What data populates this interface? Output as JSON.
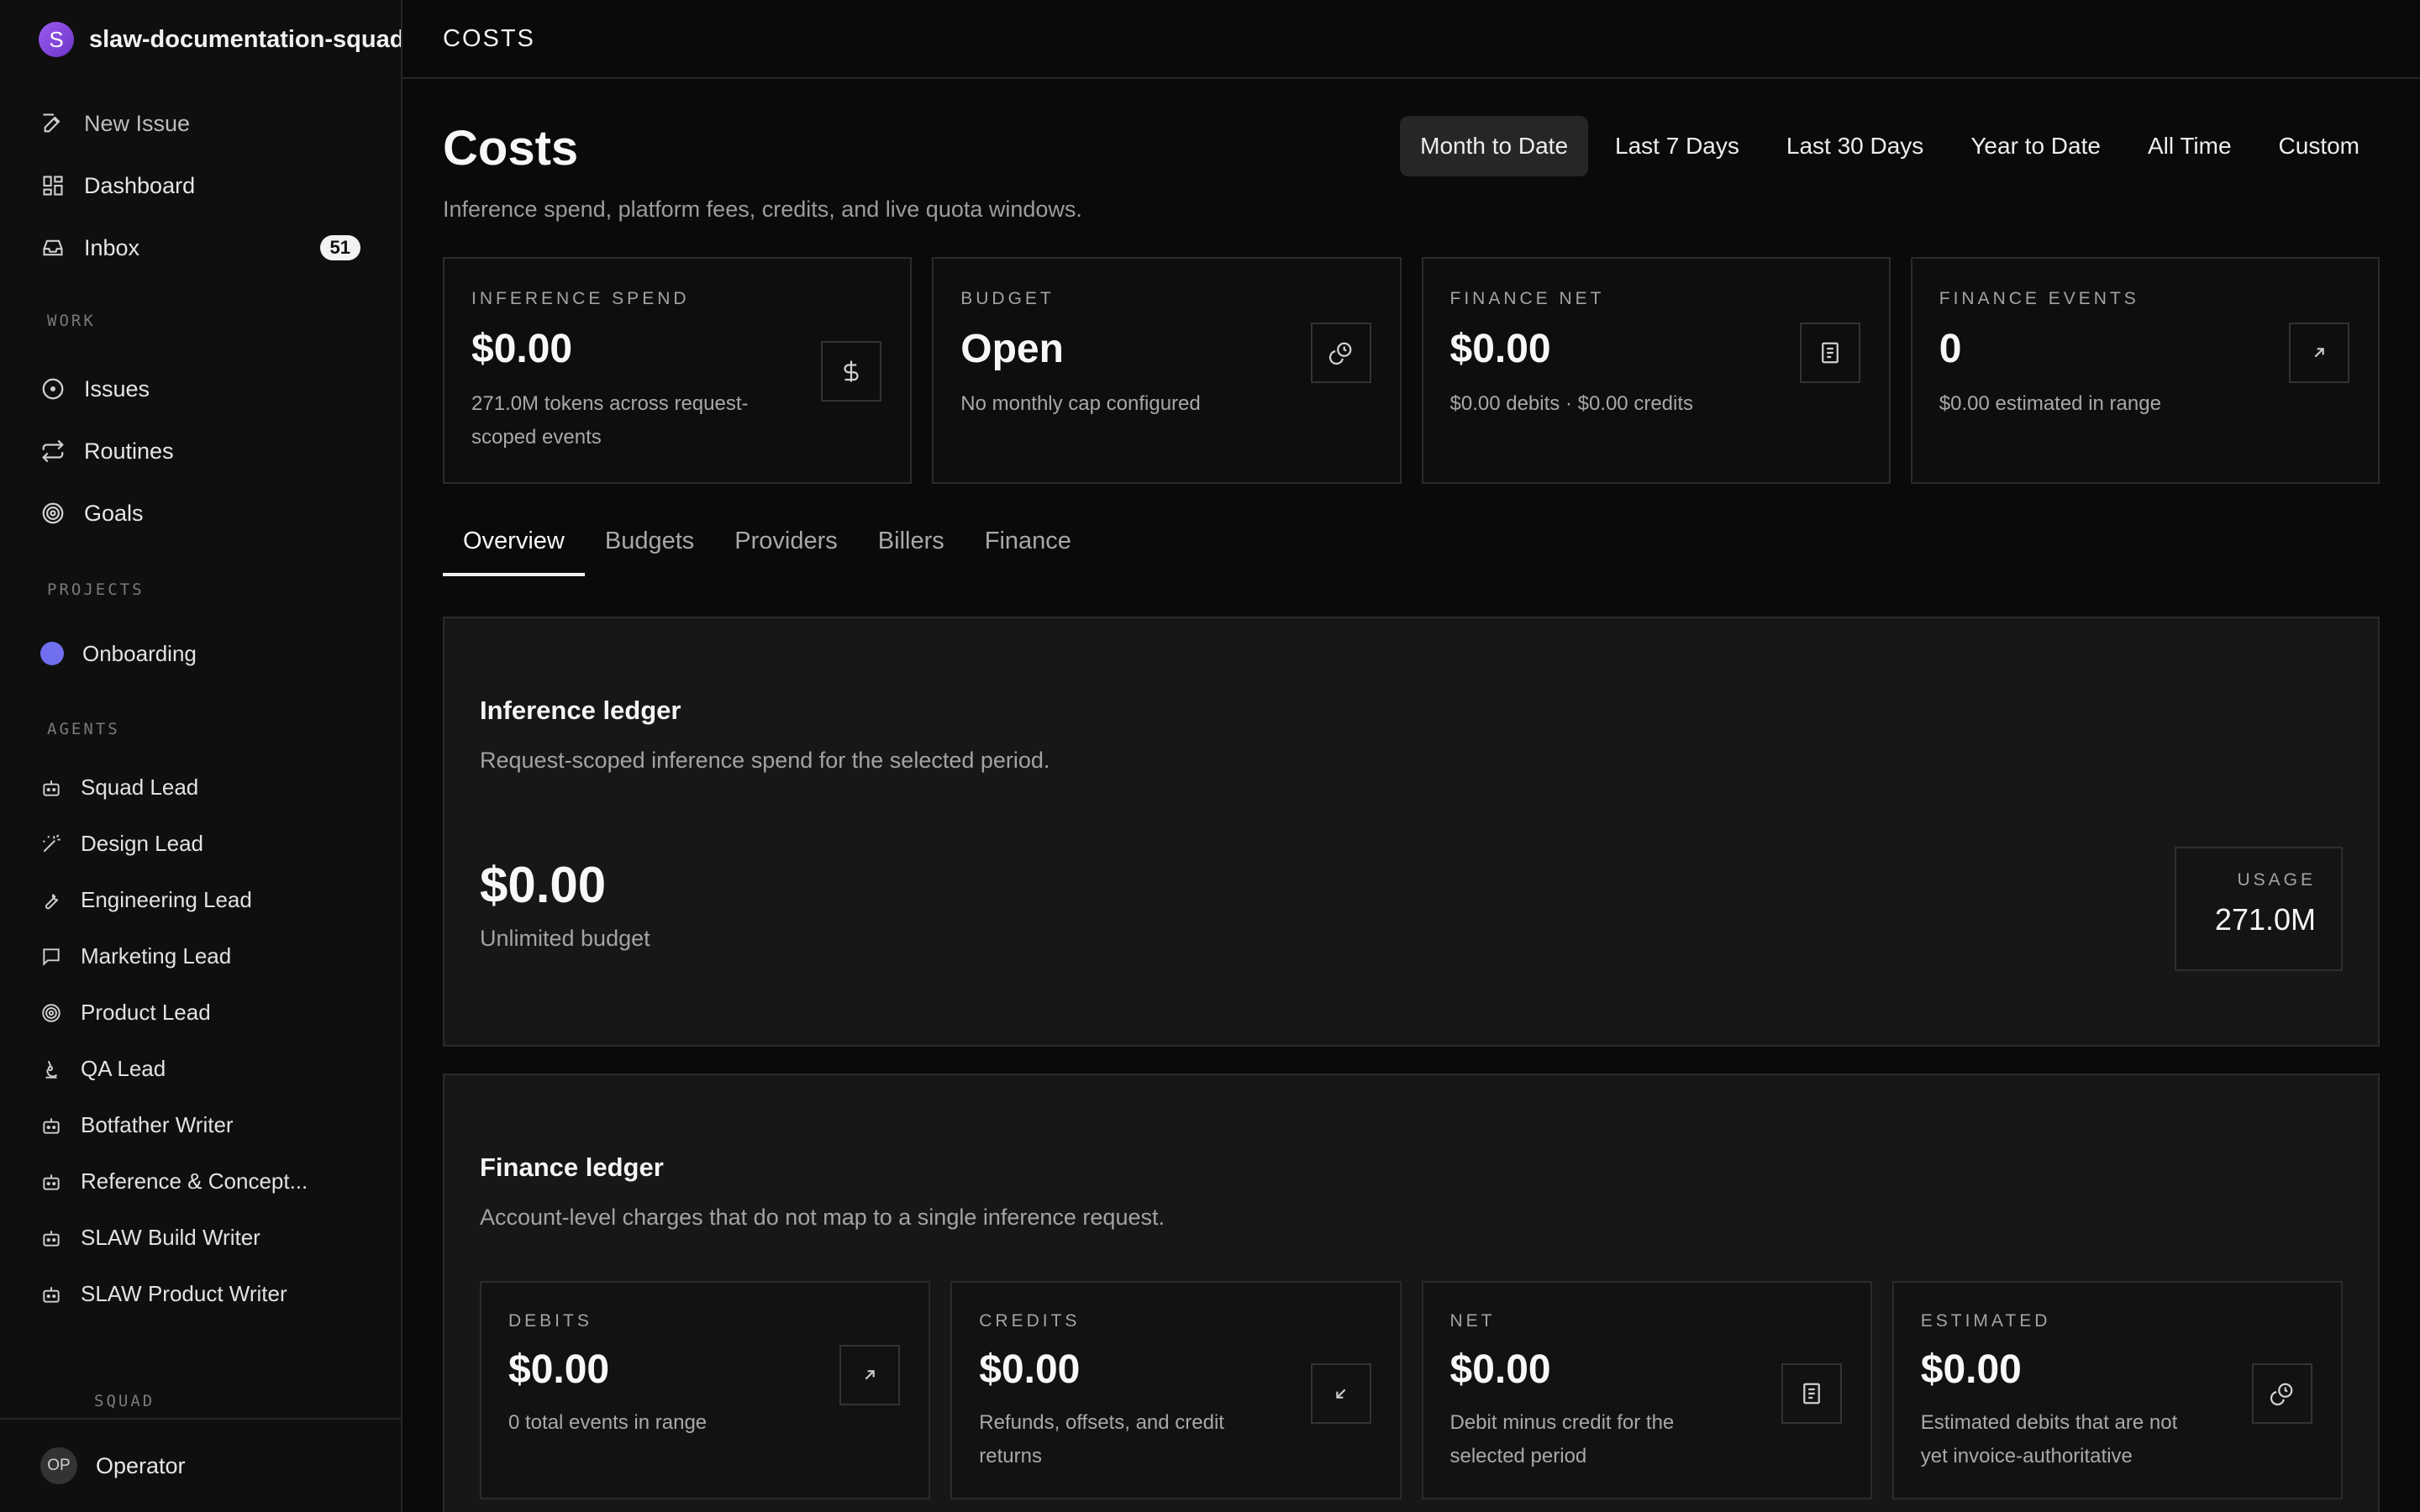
{
  "sidebar": {
    "org_initial": "S",
    "org_name": "slaw-documentation-squad",
    "nav": [
      {
        "label": "New Issue",
        "icon": "edit-icon"
      },
      {
        "label": "Dashboard",
        "icon": "grid-icon"
      },
      {
        "label": "Inbox",
        "icon": "inbox-icon",
        "badge": "51"
      }
    ],
    "work_label": "WORK",
    "work": [
      {
        "label": "Issues",
        "icon": "circle-dot-icon"
      },
      {
        "label": "Routines",
        "icon": "repeat-icon"
      },
      {
        "label": "Goals",
        "icon": "target-icon"
      }
    ],
    "projects_label": "PROJECTS",
    "projects": [
      {
        "label": "Onboarding",
        "color": "#6f6ff0"
      }
    ],
    "agents_label": "AGENTS",
    "agents": [
      {
        "label": "Squad Lead",
        "icon": "bot-icon"
      },
      {
        "label": "Design Lead",
        "icon": "wand-icon"
      },
      {
        "label": "Engineering Lead",
        "icon": "wrench-icon"
      },
      {
        "label": "Marketing Lead",
        "icon": "message-icon"
      },
      {
        "label": "Product Lead",
        "icon": "target-icon"
      },
      {
        "label": "QA Lead",
        "icon": "microscope-icon"
      },
      {
        "label": "Botfather Writer",
        "icon": "bot-icon"
      },
      {
        "label": "Reference & Concept...",
        "icon": "bot-icon"
      },
      {
        "label": "SLAW Build Writer",
        "icon": "bot-icon"
      },
      {
        "label": "SLAW Product Writer",
        "icon": "bot-icon"
      }
    ],
    "squad_label": "SQUAD",
    "user_initials": "OP",
    "user_name": "Operator"
  },
  "topbar": {
    "title": "COSTS"
  },
  "header": {
    "title": "Costs",
    "subtitle": "Inference spend, platform fees, credits, and live quota windows.",
    "ranges": [
      "Month to Date",
      "Last 7 Days",
      "Last 30 Days",
      "Year to Date",
      "All Time",
      "Custom"
    ],
    "active_range": "Month to Date"
  },
  "stats": [
    {
      "label": "INFERENCE SPEND",
      "value": "$0.00",
      "desc": "271.0M tokens across request-scoped events",
      "icon": "dollar-icon"
    },
    {
      "label": "BUDGET",
      "value": "Open",
      "desc": "No monthly cap configured",
      "icon": "coins-icon"
    },
    {
      "label": "FINANCE NET",
      "value": "$0.00",
      "desc": "$0.00 debits · $0.00 credits",
      "icon": "receipt-icon"
    },
    {
      "label": "FINANCE EVENTS",
      "value": "0",
      "desc": "$0.00 estimated in range",
      "icon": "arrow-up-right-icon"
    }
  ],
  "tabs": [
    "Overview",
    "Budgets",
    "Providers",
    "Billers",
    "Finance"
  ],
  "active_tab": "Overview",
  "inference_ledger": {
    "title": "Inference ledger",
    "subtitle": "Request-scoped inference spend for the selected period.",
    "amount": "$0.00",
    "amount_sub": "Unlimited budget",
    "usage_label": "USAGE",
    "usage_value": "271.0M"
  },
  "finance_ledger": {
    "title": "Finance ledger",
    "subtitle": "Account-level charges that do not map to a single inference request.",
    "cards": [
      {
        "label": "DEBITS",
        "value": "$0.00",
        "desc": "0 total events in range",
        "icon": "arrow-up-right-icon"
      },
      {
        "label": "CREDITS",
        "value": "$0.00",
        "desc": "Refunds, offsets, and credit returns",
        "icon": "arrow-down-left-icon"
      },
      {
        "label": "NET",
        "value": "$0.00",
        "desc": "Debit minus credit for the selected period",
        "icon": "receipt-icon"
      },
      {
        "label": "ESTIMATED",
        "value": "$0.00",
        "desc": "Estimated debits that are not yet invoice-authoritative",
        "icon": "coins-icon"
      }
    ]
  }
}
